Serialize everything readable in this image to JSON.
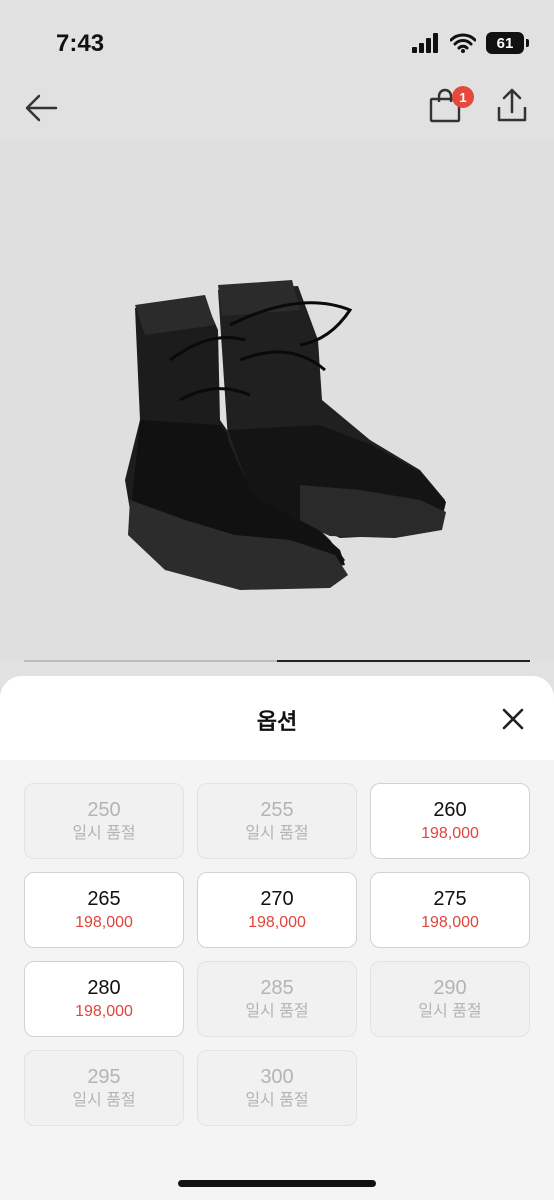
{
  "status_bar": {
    "time": "7:43",
    "battery": "61"
  },
  "nav": {
    "cart_count": "1"
  },
  "sheet": {
    "title": "옵션",
    "options": [
      {
        "size": "250",
        "status": "일시 품절",
        "available": false
      },
      {
        "size": "255",
        "status": "일시 품절",
        "available": false
      },
      {
        "size": "260",
        "status": "198,000",
        "available": true
      },
      {
        "size": "265",
        "status": "198,000",
        "available": true
      },
      {
        "size": "270",
        "status": "198,000",
        "available": true
      },
      {
        "size": "275",
        "status": "198,000",
        "available": true
      },
      {
        "size": "280",
        "status": "198,000",
        "available": true
      },
      {
        "size": "285",
        "status": "일시 품절",
        "available": false
      },
      {
        "size": "290",
        "status": "일시 품절",
        "available": false
      },
      {
        "size": "295",
        "status": "일시 품절",
        "available": false
      },
      {
        "size": "300",
        "status": "일시 품절",
        "available": false
      }
    ]
  },
  "image_progress": 0.5,
  "colors": {
    "price": "#e0443a",
    "badge": "#e5493d",
    "soldout_text": "#b4b4b4"
  }
}
